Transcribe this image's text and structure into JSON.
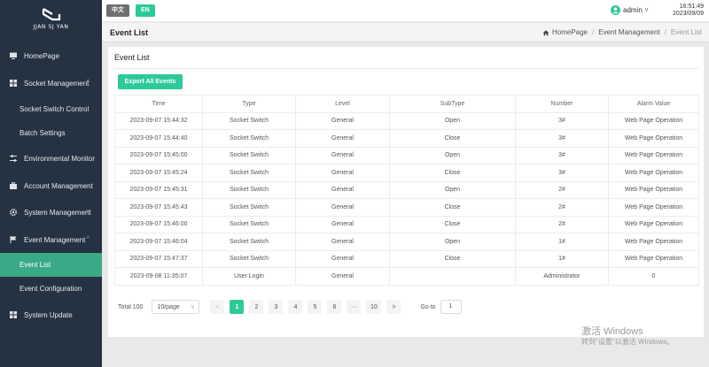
{
  "logo": {
    "text": "JJAN SJ YAN"
  },
  "sidebar": {
    "items": [
      {
        "label": "HomePage",
        "icon": "monitor-icon"
      },
      {
        "label": "Socket Management",
        "icon": "grid-icon"
      },
      {
        "label": "Socket Switch Control"
      },
      {
        "label": "Batch Settings"
      },
      {
        "label": "Environmental Monitor",
        "icon": "sliders-icon"
      },
      {
        "label": "Account Management",
        "icon": "briefcase-icon"
      },
      {
        "label": "System Management",
        "icon": "gear-icon"
      },
      {
        "label": "Event Management",
        "icon": "flag-icon"
      },
      {
        "label": "Event List"
      },
      {
        "label": "Event Configuration"
      },
      {
        "label": "System Update",
        "icon": "grid-icon"
      }
    ]
  },
  "topbar": {
    "lang_zh": "中文",
    "lang_en": "EN",
    "user": "admin",
    "time": "16:51:49",
    "date": "2023/09/09"
  },
  "header": {
    "title": "Event List",
    "breadcrumb": [
      "HomePage",
      "Event Management",
      "Event List"
    ]
  },
  "card": {
    "title": "Event List",
    "export_label": "Export All Events"
  },
  "table": {
    "columns": [
      "Time",
      "Type",
      "Level",
      "SubType",
      "Number",
      "Alarm Value"
    ],
    "rows": [
      [
        "2023-09-07 15:44:32",
        "Socket Switch",
        "General",
        "Open",
        "3#",
        "Web Page Operation"
      ],
      [
        "2023-09-07 15:44:40",
        "Socket Switch",
        "General",
        "Close",
        "3#",
        "Web Page Operation"
      ],
      [
        "2023-09-07 15:45:00",
        "Socket Switch",
        "General",
        "Open",
        "3#",
        "Web Page Operation"
      ],
      [
        "2023-09-07 15:45:24",
        "Socket Switch",
        "General",
        "Close",
        "3#",
        "Web Page Operation"
      ],
      [
        "2023-09-07 15:45:31",
        "Socket Switch",
        "General",
        "Open",
        "2#",
        "Web Page Operation"
      ],
      [
        "2023-09-07 15:45:43",
        "Socket Switch",
        "General",
        "Close",
        "2#",
        "Web Page Operation"
      ],
      [
        "2023-09-07 15:46:00",
        "Socket Switch",
        "General",
        "Close",
        "2#",
        "Web Page Operation"
      ],
      [
        "2023-09-07 15:46:04",
        "Socket Switch",
        "General",
        "Open",
        "1#",
        "Web Page Operation"
      ],
      [
        "2023-09-07 15:47:37",
        "Socket Switch",
        "General",
        "Close",
        "1#",
        "Web Page Operation"
      ],
      [
        "2023-09-08 11:35:07",
        "User Login",
        "General",
        "",
        "Administrator",
        "0"
      ]
    ]
  },
  "pagination": {
    "total": "Total 100",
    "page_size": "10/page",
    "pages": [
      "1",
      "2",
      "3",
      "4",
      "5",
      "6",
      "···",
      "10"
    ],
    "current": "1",
    "goto_label": "Go to",
    "goto_value": "1"
  },
  "watermark": {
    "line1": "激活 Windows",
    "line2": "转到\"设置\"以激活 Windows。"
  },
  "colors": {
    "accent": "#2ec99a",
    "sidebar_bg": "#253241",
    "active_item": "#3aa988"
  }
}
